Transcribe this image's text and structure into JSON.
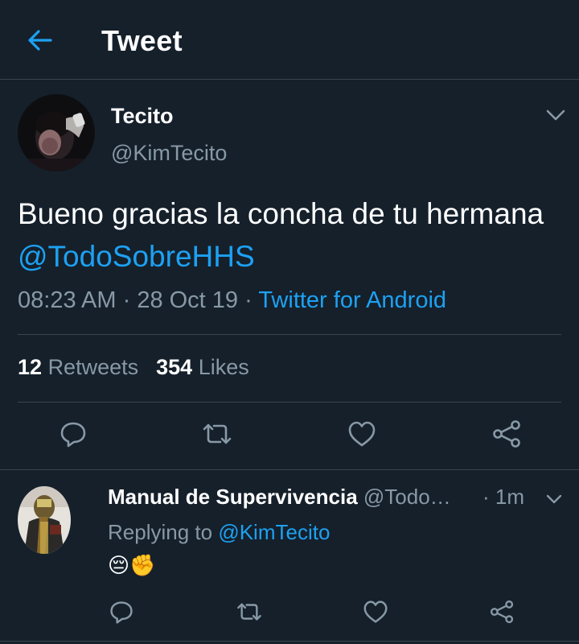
{
  "header": {
    "title": "Tweet",
    "back_icon": "arrow-left-icon"
  },
  "tweet": {
    "author_name": "Tecito",
    "author_handle": "@KimTecito",
    "text": "Bueno gracias la concha de tu hermana ",
    "mention": "@TodoSobreHHS",
    "time": "08:23 AM",
    "date": "28 Oct 19",
    "separator": " · ",
    "source": "Twitter for Android",
    "retweets_count": "12",
    "retweets_label": "Retweets",
    "likes_count": "354",
    "likes_label": "Likes"
  },
  "reply": {
    "author_name": "Manual de Supervivencia",
    "author_handle": "@Todo…",
    "time": "· 1m",
    "replying_prefix": "Replying to ",
    "replying_to": "@KimTecito",
    "text": "😔✊"
  },
  "colors": {
    "background": "#15202b",
    "accent": "#1da1f2",
    "secondary_text": "#8899a6",
    "divider": "#38444d"
  }
}
